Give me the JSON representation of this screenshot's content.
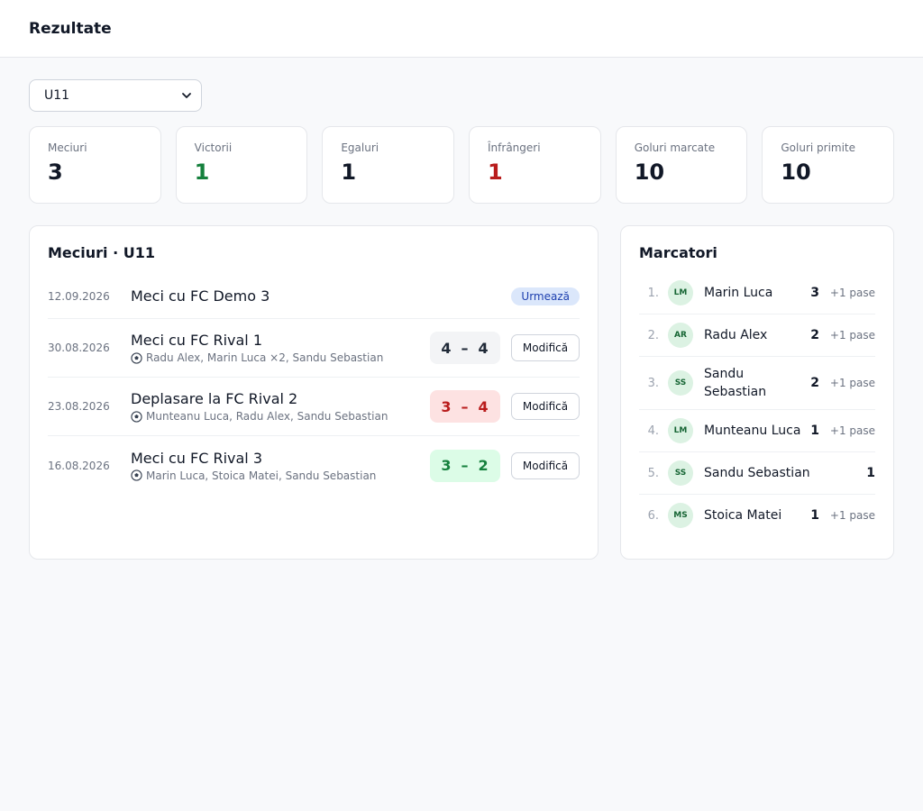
{
  "header": {
    "title": "Rezultate"
  },
  "team_select": {
    "value": "U11",
    "icon": "chevron-down-icon"
  },
  "stats": [
    {
      "label": "Meciuri",
      "value": "3",
      "tone": "neutral"
    },
    {
      "label": "Victorii",
      "value": "1",
      "tone": "green"
    },
    {
      "label": "Egaluri",
      "value": "1",
      "tone": "neutral"
    },
    {
      "label": "Înfrângeri",
      "value": "1",
      "tone": "red"
    },
    {
      "label": "Goluri marcate",
      "value": "10",
      "tone": "neutral"
    },
    {
      "label": "Goluri primite",
      "value": "10",
      "tone": "neutral"
    }
  ],
  "matches": {
    "title": "Meciuri · U11",
    "items": [
      {
        "date": "12.09.2026",
        "title": "Meci cu FC Demo 3",
        "status": "Urmează"
      },
      {
        "date": "30.08.2026",
        "title": "Meci cu FC Rival 1",
        "scorers": "Radu Alex, Marin Luca ×2, Sandu Sebastian",
        "home": "4",
        "away": "4",
        "result": "draw",
        "action": "Modifică"
      },
      {
        "date": "23.08.2026",
        "title": "Deplasare la FC Rival 2",
        "scorers": "Munteanu Luca, Radu Alex, Sandu Sebastian",
        "home": "3",
        "away": "4",
        "result": "loss",
        "action": "Modifică"
      },
      {
        "date": "16.08.2026",
        "title": "Meci cu FC Rival 3",
        "scorers": "Marin Luca, Stoica Matei, Sandu Sebastian",
        "home": "3",
        "away": "2",
        "result": "win",
        "action": "Modifică"
      }
    ],
    "score_dash": "–",
    "scorer_icon": "soccer-ball-icon"
  },
  "scorers": {
    "title": "Marcatori",
    "items": [
      {
        "rank": "1.",
        "initials": "LM",
        "name": "Marin Luca",
        "goals": "3",
        "assists": "+1 pase"
      },
      {
        "rank": "2.",
        "initials": "AR",
        "name": "Radu Alex",
        "goals": "2",
        "assists": "+1 pase"
      },
      {
        "rank": "3.",
        "initials": "SS",
        "name": "Sandu Sebastian",
        "goals": "2",
        "assists": "+1 pase"
      },
      {
        "rank": "4.",
        "initials": "LM",
        "name": "Munteanu Luca",
        "goals": "1",
        "assists": "+1 pase"
      },
      {
        "rank": "5.",
        "initials": "SS",
        "name": "Sandu Sebastian",
        "goals": "1",
        "assists": ""
      },
      {
        "rank": "6.",
        "initials": "MS",
        "name": "Stoica Matei",
        "goals": "1",
        "assists": "+1 pase"
      }
    ]
  },
  "colors": {
    "win": "#15803d",
    "loss": "#b91c1c",
    "badge_bg": "#dbe7fb",
    "avatar_bg": "#dcf2e3"
  }
}
